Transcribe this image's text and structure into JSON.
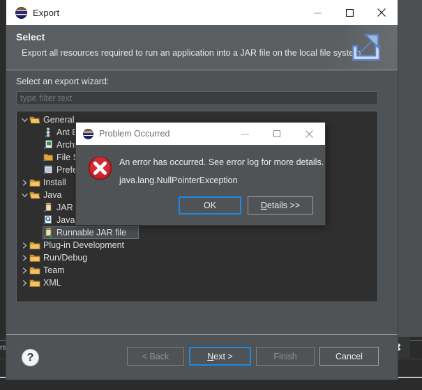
{
  "background": {
    "tab_text": "rs",
    "close_icon": "close-icon"
  },
  "wizard": {
    "title": "Export",
    "logo_icon": "eclipse-logo-icon",
    "window_controls": [
      {
        "name": "minimize",
        "icon": "minimize-icon"
      },
      {
        "name": "maximize",
        "icon": "maximize-icon"
      },
      {
        "name": "close",
        "icon": "close-icon"
      }
    ],
    "banner": {
      "title": "Select",
      "description": "Export all resources required to run an application into a JAR file on the local file system.",
      "icon": "export-arrow-icon"
    },
    "tree_label": "Select an export wizard:",
    "filter": {
      "value": "",
      "placeholder": "type filter text"
    },
    "tree": [
      {
        "label": "General",
        "indent": 0,
        "twisty": "expanded",
        "icon": "folder-open-icon",
        "selected": false
      },
      {
        "label": "Ant Buildfiles",
        "indent": 1,
        "twisty": "none",
        "icon": "ant-icon",
        "selected": false
      },
      {
        "label": "Archive File",
        "indent": 1,
        "twisty": "none",
        "icon": "archive-icon",
        "selected": false
      },
      {
        "label": "File System",
        "indent": 1,
        "twisty": "none",
        "icon": "file-system-icon",
        "selected": false
      },
      {
        "label": "Preferences",
        "indent": 1,
        "twisty": "none",
        "icon": "preferences-icon",
        "selected": false
      },
      {
        "label": "Install",
        "indent": 0,
        "twisty": "collapsed",
        "icon": "folder-icon",
        "selected": false
      },
      {
        "label": "Java",
        "indent": 0,
        "twisty": "expanded",
        "icon": "folder-open-icon",
        "selected": false
      },
      {
        "label": "JAR file",
        "indent": 1,
        "twisty": "none",
        "icon": "jar-icon",
        "selected": false
      },
      {
        "label": "Javadoc",
        "indent": 1,
        "twisty": "none",
        "icon": "javadoc-icon",
        "selected": false
      },
      {
        "label": "Runnable JAR file",
        "indent": 1,
        "twisty": "none",
        "icon": "runnable-jar-icon",
        "selected": true
      },
      {
        "label": "Plug-in Development",
        "indent": 0,
        "twisty": "collapsed",
        "icon": "folder-icon",
        "selected": false
      },
      {
        "label": "Run/Debug",
        "indent": 0,
        "twisty": "collapsed",
        "icon": "folder-icon",
        "selected": false
      },
      {
        "label": "Team",
        "indent": 0,
        "twisty": "collapsed",
        "icon": "folder-icon",
        "selected": false
      },
      {
        "label": "XML",
        "indent": 0,
        "twisty": "collapsed",
        "icon": "folder-icon",
        "selected": false
      }
    ],
    "footer": {
      "help_label": "?",
      "buttons": [
        {
          "label": "< Back",
          "state": "disabled",
          "name": "back-button"
        },
        {
          "label": "Next >",
          "state": "focused",
          "name": "next-button",
          "mnemonic": "N"
        },
        {
          "label": "Finish",
          "state": "disabled",
          "name": "finish-button"
        },
        {
          "label": "Cancel",
          "state": "normal",
          "name": "cancel-button"
        }
      ]
    }
  },
  "error_dialog": {
    "title": "Problem Occurred",
    "logo_icon": "eclipse-logo-icon",
    "icon": "error-icon",
    "message_line1": "An error has occurred. See error log for more details.",
    "message_line2": "java.lang.NullPointerException",
    "window_controls": [
      {
        "name": "minimize",
        "icon": "minimize-icon"
      },
      {
        "name": "maximize",
        "icon": "maximize-icon"
      },
      {
        "name": "close",
        "icon": "close-icon"
      }
    ],
    "buttons": [
      {
        "label": "OK",
        "state": "focused",
        "name": "ok-button"
      },
      {
        "label": "Details >>",
        "state": "normal",
        "name": "details-button",
        "mnemonic": "D"
      }
    ]
  },
  "colors": {
    "dialog_bg": "#4f5356",
    "banner_bg": "#5a5e61",
    "tree_bg": "#2f2f2f",
    "titlebar_bg": "#ffffff",
    "focus_blue": "#1a8ae5",
    "error_red": "#c8232c",
    "folder_gold": "#e8a33d"
  }
}
